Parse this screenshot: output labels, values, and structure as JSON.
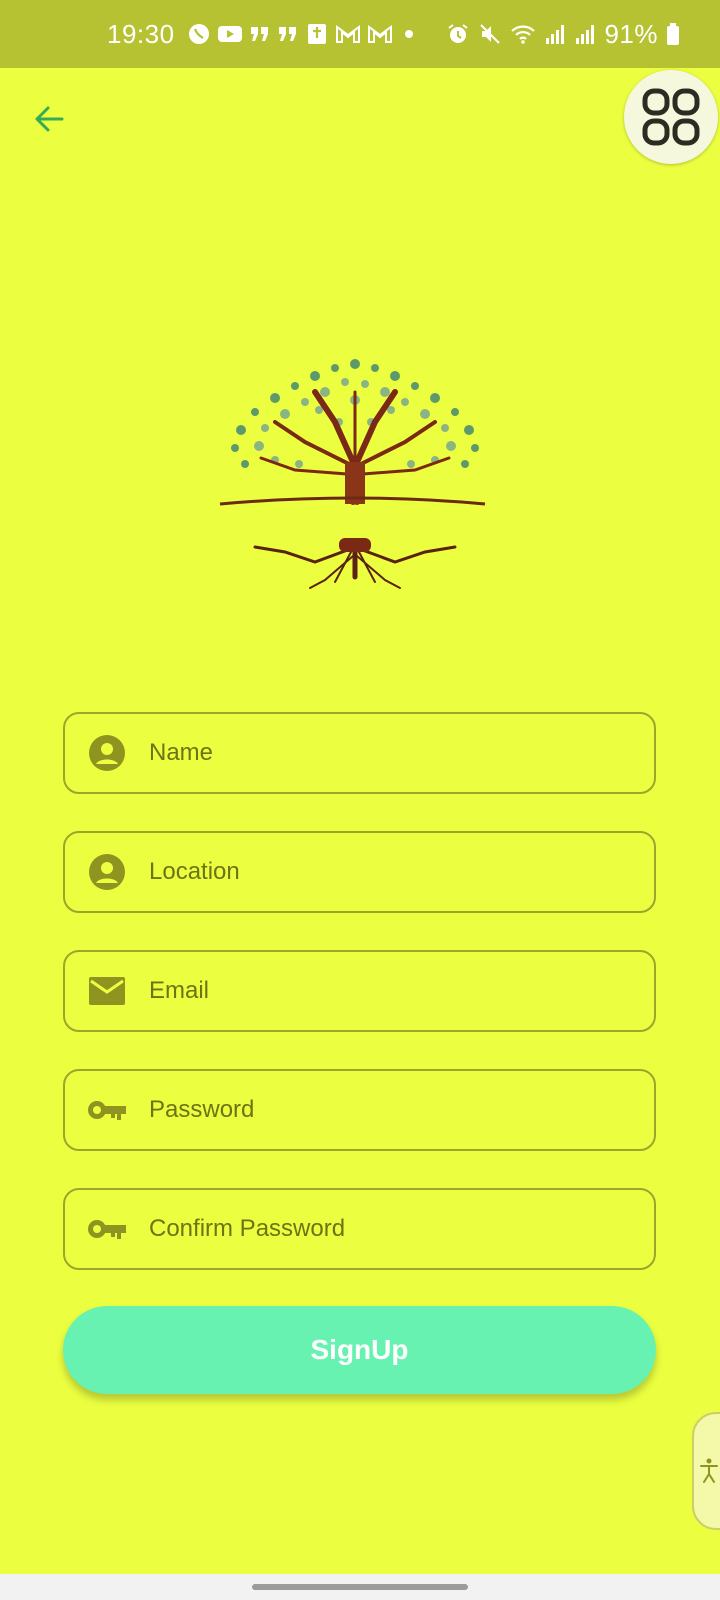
{
  "status_bar": {
    "time": "19:30",
    "battery_percent": "91%",
    "notification_icons": [
      "whatsapp-icon",
      "youtube-icon",
      "quote-icon",
      "quote-icon",
      "bible-icon",
      "gmail-icon",
      "gmail-icon",
      "dot-icon"
    ],
    "system_icons": [
      "alarm-icon",
      "mute-icon",
      "wifi-icon",
      "signal-icon",
      "signal-icon",
      "battery-icon"
    ]
  },
  "header": {
    "back_icon": "arrow-back-icon",
    "menu_icon": "grid-icon"
  },
  "form": {
    "fields": [
      {
        "placeholder": "Name",
        "icon": "person-icon"
      },
      {
        "placeholder": "Location",
        "icon": "person-icon"
      },
      {
        "placeholder": "Email",
        "icon": "mail-icon"
      },
      {
        "placeholder": "Password",
        "icon": "key-icon"
      },
      {
        "placeholder": "Confirm Password",
        "icon": "key-icon"
      }
    ],
    "submit_label": "SignUp"
  },
  "colors": {
    "background": "#EBFF40",
    "status_bar": "#B6C231",
    "field_border": "#9FA42A",
    "field_text": "#6E7413",
    "button": "#68F2B2",
    "back_arrow": "#3BAA55"
  }
}
